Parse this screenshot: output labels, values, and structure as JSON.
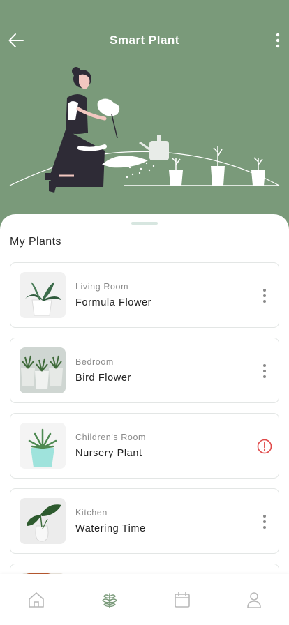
{
  "app": {
    "title": "Smart Plant"
  },
  "header": {
    "back_icon": "arrow-left-icon",
    "menu_icon": "more-vertical-icon"
  },
  "section": {
    "title": "My Plants"
  },
  "plants": [
    {
      "room": "Living Room",
      "name": "Formula Flower",
      "action_icon": "more-vertical-icon"
    },
    {
      "room": "Bedroom",
      "name": "Bird Flower",
      "action_icon": "more-vertical-icon"
    },
    {
      "room": "Children's Room",
      "name": "Nursery Plant",
      "action_icon": "alert-circle-icon"
    },
    {
      "room": "Kitchen",
      "name": "Watering Time",
      "action_icon": "more-vertical-icon"
    }
  ],
  "tabbar": {
    "items": [
      {
        "icon": "home-icon",
        "active": false
      },
      {
        "icon": "plant-icon",
        "active": true
      },
      {
        "icon": "calendar-icon",
        "active": false
      },
      {
        "icon": "user-icon",
        "active": false
      }
    ]
  },
  "colors": {
    "header_bg": "#7a9a7a",
    "accent": "#7a9a7a",
    "alert": "#e04848",
    "inactive_icon": "#b8b8b8"
  }
}
